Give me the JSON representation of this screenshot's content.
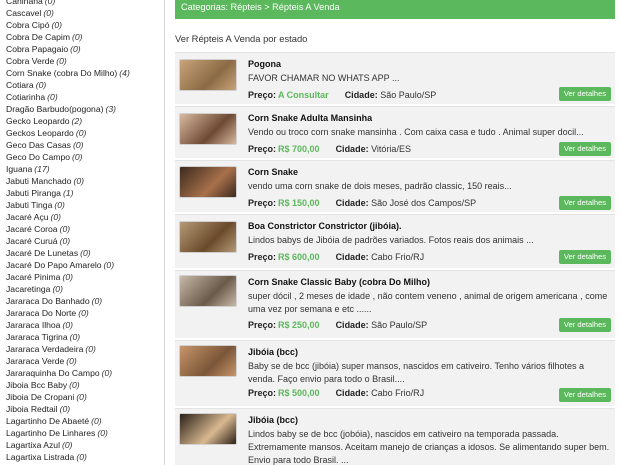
{
  "sidebar": {
    "items": [
      {
        "label": "Caninana",
        "count": "(0)"
      },
      {
        "label": "Cascavel",
        "count": "(0)"
      },
      {
        "label": "Cobra Cipó",
        "count": "(0)"
      },
      {
        "label": "Cobra De Capim",
        "count": "(0)"
      },
      {
        "label": "Cobra Papagaio",
        "count": "(0)"
      },
      {
        "label": "Cobra Verde",
        "count": "(0)"
      },
      {
        "label": "Corn Snake (cobra Do Milho)",
        "count": "(4)"
      },
      {
        "label": "Cotiara",
        "count": "(0)"
      },
      {
        "label": "Cotiarinha",
        "count": "(0)"
      },
      {
        "label": "Dragão Barbudo(pogona)",
        "count": "(3)"
      },
      {
        "label": "Gecko Leopardo",
        "count": "(2)"
      },
      {
        "label": "Geckos Leopardo",
        "count": "(0)"
      },
      {
        "label": "Geco Das Casas",
        "count": "(0)"
      },
      {
        "label": "Geco Do Campo",
        "count": "(0)"
      },
      {
        "label": "Iguana",
        "count": "(17)"
      },
      {
        "label": "Jabuti Manchado",
        "count": "(0)"
      },
      {
        "label": "Jabuti Piranga",
        "count": "(1)"
      },
      {
        "label": "Jabuti Tinga",
        "count": "(0)"
      },
      {
        "label": "Jacaré Açu",
        "count": "(0)"
      },
      {
        "label": "Jacaré Coroa",
        "count": "(0)"
      },
      {
        "label": "Jacaré Curuá",
        "count": "(0)"
      },
      {
        "label": "Jacaré De Lunetas",
        "count": "(0)"
      },
      {
        "label": "Jacaré Do Papo Amarelo",
        "count": "(0)"
      },
      {
        "label": "Jacaré Pinima",
        "count": "(0)"
      },
      {
        "label": "Jacaretinga",
        "count": "(0)"
      },
      {
        "label": "Jararaca Do Banhado",
        "count": "(0)"
      },
      {
        "label": "Jararaca Do Norte",
        "count": "(0)"
      },
      {
        "label": "Jararaca Ilhoa",
        "count": "(0)"
      },
      {
        "label": "Jararaca Tigrina",
        "count": "(0)"
      },
      {
        "label": "Jararaca Verdadeira",
        "count": "(0)"
      },
      {
        "label": "Jararaca Verde",
        "count": "(0)"
      },
      {
        "label": "Jararaquinha Do Campo",
        "count": "(0)"
      },
      {
        "label": "Jiboia Bcc Baby",
        "count": "(0)"
      },
      {
        "label": "Jiboia De Cropani",
        "count": "(0)"
      },
      {
        "label": "Jiboia Redtail",
        "count": "(0)"
      },
      {
        "label": "Lagartinho De Abaeté",
        "count": "(0)"
      },
      {
        "label": "Lagartinho De Linhares",
        "count": "(0)"
      },
      {
        "label": "Lagartixa Azul",
        "count": "(0)"
      },
      {
        "label": "Lagartixa Listrada",
        "count": "(0)"
      }
    ]
  },
  "breadcrumb": "Categorias: Répteis > Répteis A Venda",
  "state_title": "Ver Répteis A Venda por estado",
  "labels": {
    "price": "Preço:",
    "city": "Cidade:",
    "details": "Ver detalhes"
  },
  "colors": {
    "accent": "#5cb85c",
    "card_bg": "#f2f2f2"
  },
  "listings": [
    {
      "title": "Pogona",
      "desc": "FAVOR CHAMAR NO WHATS APP ...",
      "price": "A Consultar",
      "city": "São Paulo/SP"
    },
    {
      "title": "Corn Snake Adulta Mansinha",
      "desc": "Vendo ou troco corn snake mansinha . Com caixa casa e tudo . Animal super docil...",
      "price": "R$ 700,00",
      "city": "Vitória/ES"
    },
    {
      "title": "Corn Snake",
      "desc": "vendo uma corn snake de dois meses, padrão classic, 150 reais...",
      "price": "R$ 150,00",
      "city": "São José dos Campos/SP"
    },
    {
      "title": "Boa Constrictor Constrictor (jibóia).",
      "desc": "Lindos babys de Jibóia de padrões variados. Fotos reais dos animais ...",
      "price": "R$ 600,00",
      "city": "Cabo Frio/RJ"
    },
    {
      "title": "Corn Snake Classic Baby (cobra Do Milho)",
      "desc": "super dócil , 2 meses de idade , não contem veneno , animal de origem americana , come uma vez por semana e etc ......",
      "price": "R$ 250,00",
      "city": "São Paulo/SP"
    },
    {
      "title": "Jibóia (bcc)",
      "desc": "Baby se de bcc (jibóia) super mansos, nascidos em cativeiro. Tenho vários filhotes a venda. Faço envio para todo o Brasil....",
      "price": "R$ 500,00",
      "city": "Cabo Frio/RJ"
    },
    {
      "title": "Jibóia (bcc)",
      "desc": "Lindos baby se de bcc (jobóia), nascidos em cativeiro na temporada passada. Extremamente mansos. Aceitam manejo de crianças a idosos. Se alimentando super bem. Envio para todo Brasil. ...",
      "price": "",
      "city": ""
    }
  ]
}
